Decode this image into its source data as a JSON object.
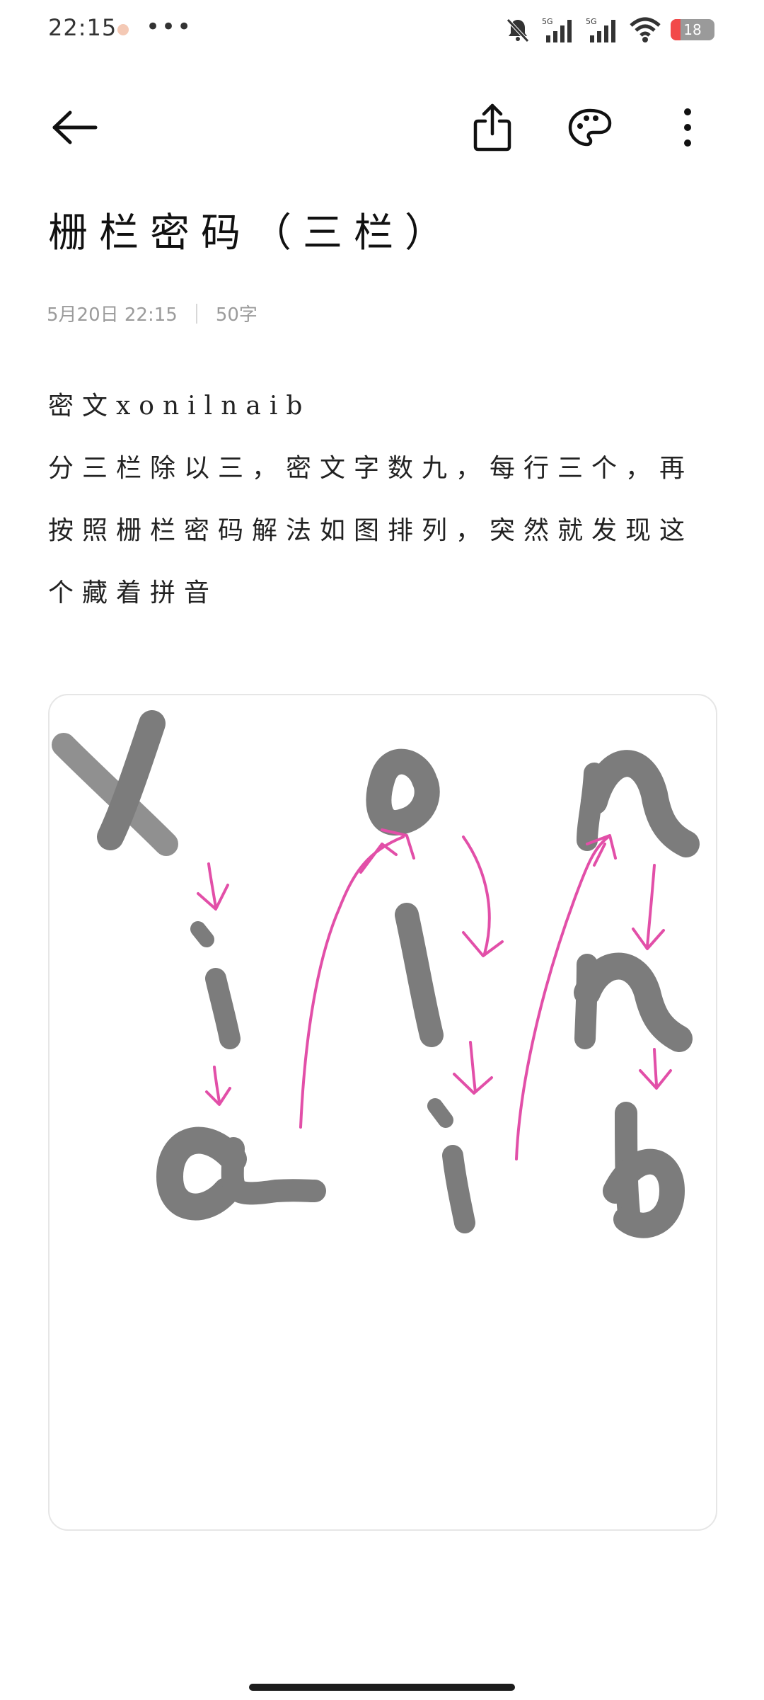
{
  "status_bar": {
    "time": "22:15",
    "battery": "18"
  },
  "toolbar": {
    "back_icon": "arrow-left-icon",
    "share_icon": "share-icon",
    "palette_icon": "palette-icon",
    "more_icon": "more-vertical-icon"
  },
  "note": {
    "title": "栅栏密码（三栏）",
    "date": "5月20日 22:15",
    "word_count": "50字",
    "lines": [
      "密文xonilnaib",
      "分三栏除以三，密文字数九，每行三个，再按照栅栏密码解法如图排列，突然就发现这个藏着拼音"
    ]
  },
  "image": {
    "grid_rows": [
      [
        "x",
        "o",
        "n"
      ],
      [
        "i",
        "l",
        "n"
      ],
      [
        "a",
        "i",
        "b"
      ]
    ]
  },
  "colors": {
    "ink": "#7c7c7c",
    "arrow": "#e24fa8"
  }
}
